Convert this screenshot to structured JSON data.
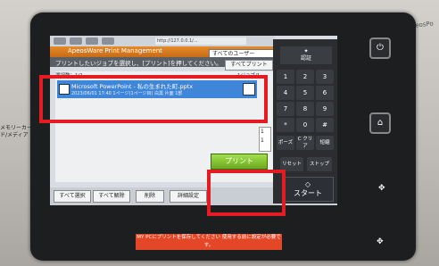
{
  "background": {
    "brand_text": "ApeosPo"
  },
  "side_print": {
    "text": "メモリーカード/メディア"
  },
  "screen": {
    "url_text": "http://127.0.0.1/...",
    "app_title": "ApeosWare Print Management",
    "user_select": "すべてのユーザー",
    "instruction": "プリントしたいジョブを選択し、[プリント]を押してください。",
    "all_print_label": "すべてプリント",
    "list_header": "選択数：1/1",
    "list_header_right": "1ジョブ/1",
    "job": {
      "name": "Microsoft PowerPoint - 私の生まれた町.pptx",
      "meta": "2023/06/01 17:40    1ページ(1ページ目)    白黒  片面    1部"
    },
    "scroll_numbers": [
      "1",
      "1"
    ],
    "buttons": {
      "select_all": "すべて選択",
      "deselect_all": "すべて解除",
      "delete": "削除",
      "detail": "詳細設定",
      "print": "プリント"
    }
  },
  "keypad": {
    "auth_label": "認証",
    "keys": [
      "1",
      "2",
      "3",
      "4",
      "5",
      "6",
      "7",
      "8",
      "9",
      "*",
      "0",
      "#"
    ],
    "pause_label": "ポーズ",
    "clear_label": "C\nクリア",
    "dial_label": "短縮",
    "reset_label": "リセット",
    "stop_label": "ストップ",
    "start_label": "スタート"
  },
  "notice": "MY PCにプリントを保存してください\n使用する前に設定が必要です。",
  "colors": {
    "highlight": "#e51b24",
    "print_button": "#8fd23a",
    "title_bar": "#e58b2a",
    "job_row": "#3f86d9"
  }
}
